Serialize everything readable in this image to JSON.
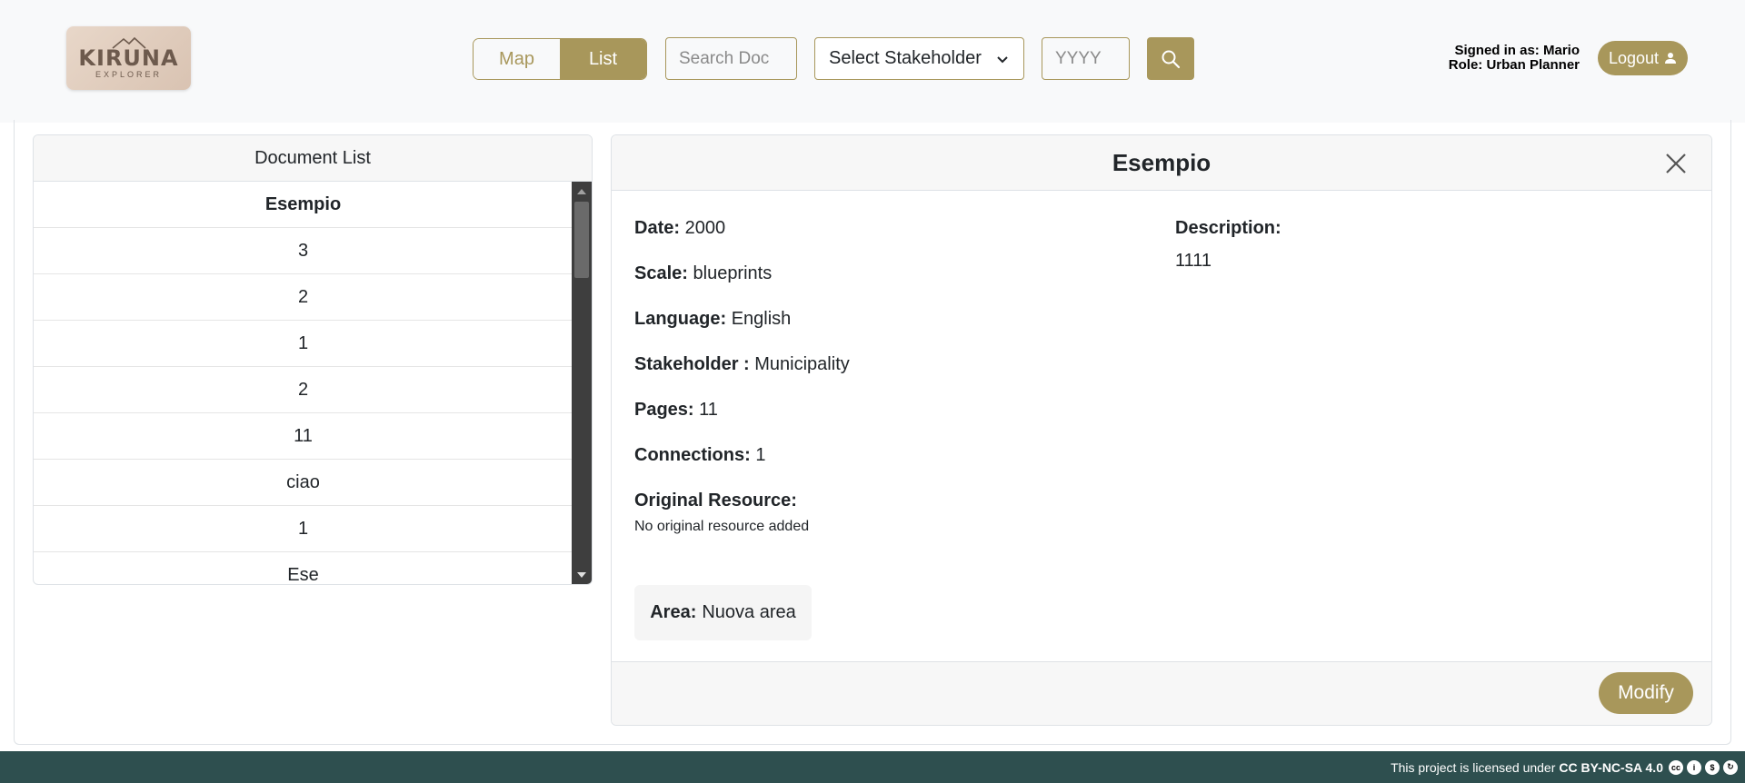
{
  "header": {
    "logo": {
      "title": "KIRUNA",
      "subtitle": "EXPLORER"
    },
    "view_toggle": {
      "map_label": "Map",
      "list_label": "List",
      "active": "List"
    },
    "search": {
      "placeholder": "Search Doc",
      "value": ""
    },
    "stakeholder_select": {
      "selected": "Select Stakeholder"
    },
    "year_input": {
      "placeholder": "YYYY",
      "value": ""
    },
    "user": {
      "signed_in_prefix": "Signed in as:",
      "name": "Mario",
      "role_prefix": "Role:",
      "role": "Urban Planner"
    },
    "logout_label": "Logout"
  },
  "document_list": {
    "title": "Document List",
    "items": [
      "Esempio",
      "3",
      "2",
      "1",
      "2",
      "11",
      "ciao",
      "1",
      "Ese"
    ],
    "selected_index": 0
  },
  "detail": {
    "title": "Esempio",
    "date": {
      "label": "Date:",
      "value": "2000"
    },
    "scale": {
      "label": "Scale:",
      "value": "blueprints"
    },
    "language": {
      "label": "Language:",
      "value": "English"
    },
    "stakeholder": {
      "label": "Stakeholder :",
      "value": "Municipality"
    },
    "pages": {
      "label": "Pages:",
      "value": "11"
    },
    "connections": {
      "label": "Connections:",
      "value": "1"
    },
    "original_resource": {
      "label": "Original Resource:",
      "value": "No original resource added"
    },
    "description": {
      "label": "Description:",
      "value": "1111"
    },
    "area": {
      "label": "Area:",
      "value": "Nuova area"
    },
    "modify_label": "Modify"
  },
  "footer": {
    "text": "This project is licensed under",
    "license": "CC BY-NC-SA 4.0",
    "icons": [
      "cc-icon",
      "by-icon",
      "nc-icon",
      "sa-icon"
    ]
  },
  "colors": {
    "accent": "#a8975b",
    "header_bg": "#f8f9fa",
    "footer_bg": "#2e4f4f"
  }
}
